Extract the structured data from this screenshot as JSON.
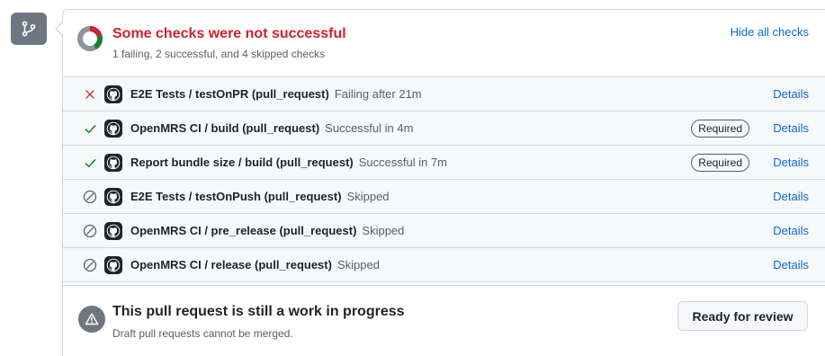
{
  "colors": {
    "failure": "#cf222e",
    "success": "#1a7f37",
    "skipped": "#57606a",
    "link": "#0969da"
  },
  "summary": {
    "title": "Some checks were not successful",
    "subtitle": "1 failing, 2 successful, and 4 skipped checks",
    "hide_label": "Hide all checks",
    "counts": {
      "failing": 1,
      "successful": 2,
      "skipped": 4
    }
  },
  "checks": [
    {
      "state": "failing",
      "status_icon": "x-icon",
      "name": "E2E Tests / testOnPR (pull_request)",
      "status_text": "Failing after 21m",
      "required": "",
      "details": "Details"
    },
    {
      "state": "success",
      "status_icon": "check-icon",
      "name": "OpenMRS CI / build (pull_request)",
      "status_text": "Successful in 4m",
      "required": "Required",
      "details": "Details"
    },
    {
      "state": "success",
      "status_icon": "check-icon",
      "name": "Report bundle size / build (pull_request)",
      "status_text": "Successful in 7m",
      "required": "Required",
      "details": "Details"
    },
    {
      "state": "skipped",
      "status_icon": "skip-icon",
      "name": "E2E Tests / testOnPush (pull_request)",
      "status_text": "Skipped",
      "required": "",
      "details": "Details"
    },
    {
      "state": "skipped",
      "status_icon": "skip-icon",
      "name": "OpenMRS CI / pre_release (pull_request)",
      "status_text": "Skipped",
      "required": "",
      "details": "Details"
    },
    {
      "state": "skipped",
      "status_icon": "skip-icon",
      "name": "OpenMRS CI / release (pull_request)",
      "status_text": "Skipped",
      "required": "",
      "details": "Details"
    }
  ],
  "draft": {
    "title": "This pull request is still a work in progress",
    "subtitle": "Draft pull requests cannot be merged.",
    "button_label": "Ready for review"
  }
}
